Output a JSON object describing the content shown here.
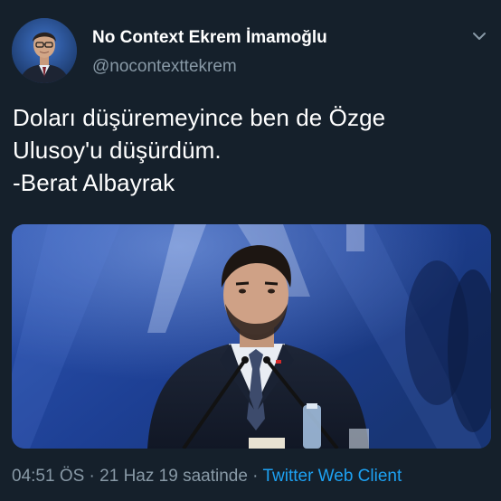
{
  "author": {
    "display_name": "No Context Ekrem İmamoğlu",
    "handle": "@nocontexttekrem"
  },
  "tweet": {
    "lines": [
      "Doları düşüremeyince ben de Özge",
      "Ulusoy'u düşürdüm.",
      "-Berat Albayrak"
    ]
  },
  "meta": {
    "time": "04:51 ÖS",
    "separator": " · ",
    "date": "21 Haz 19 saatinde",
    "source": "Twitter Web Client"
  },
  "icons": {
    "menu": "chevron-down-icon"
  },
  "colors": {
    "background": "#15202b",
    "secondary_text": "#8899a6",
    "link": "#1da1f2"
  }
}
